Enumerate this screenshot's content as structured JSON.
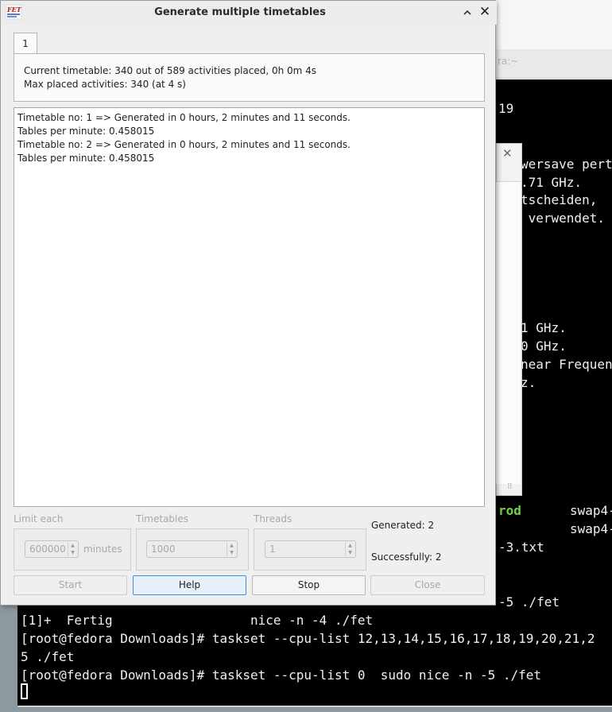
{
  "dialog": {
    "title": "Generate multiple timetables",
    "tab_label": "1",
    "current_status": "Current timetable: 340 out of 589 activities placed, 0h 0m 4s",
    "max_placed": "Max placed activities: 340 (at 4 s)",
    "log_lines": [
      "Timetable no: 1 => Generated in 0 hours, 2 minutes and 11 seconds.",
      "Tables per minute: 0.458015",
      "Timetable no: 2 => Generated in 0 hours, 2 minutes and 11 seconds.",
      "Tables per minute: 0.458015"
    ],
    "limit_each": {
      "label": "Limit each",
      "value": "600000",
      "unit": "minutes"
    },
    "timetables": {
      "label": "Timetables",
      "value": "1000"
    },
    "threads": {
      "label": "Threads",
      "value": "1"
    },
    "generated": "Generated: 2",
    "successfully": "Successfully: 2",
    "buttons": {
      "start": "Start",
      "help": "Help",
      "stop": "Stop",
      "close": "Close"
    }
  },
  "terminal": {
    "tab_text": "ra:~",
    "lines": [
      "19",
      "wersave pert",
      ".71 GHz.",
      "tscheiden,",
      " verwendet.",
      "1 GHz.",
      "0 GHz.",
      "near Frequen",
      "z.",
      "rod",
      "swap4-",
      "swap4-",
      "-3.txt",
      "-5 ./fet",
      "[1]+  Fertig                  nice -n -4 ./fet",
      "[root@fedora Downloads]# taskset --cpu-list 12,13,14,15,16,17,18,19,20,21,2",
      "5 ./fet",
      "[root@fedora Downloads]# taskset --cpu-list 0  sudo nice -n -5 ./fet"
    ]
  },
  "colors": {
    "focus_accent": "#3d8ee0",
    "terminal_green": "#6fd23f"
  },
  "icons": {
    "app": "fet-app-icon",
    "maximize": "chevron-up-icon",
    "close": "close-icon"
  }
}
